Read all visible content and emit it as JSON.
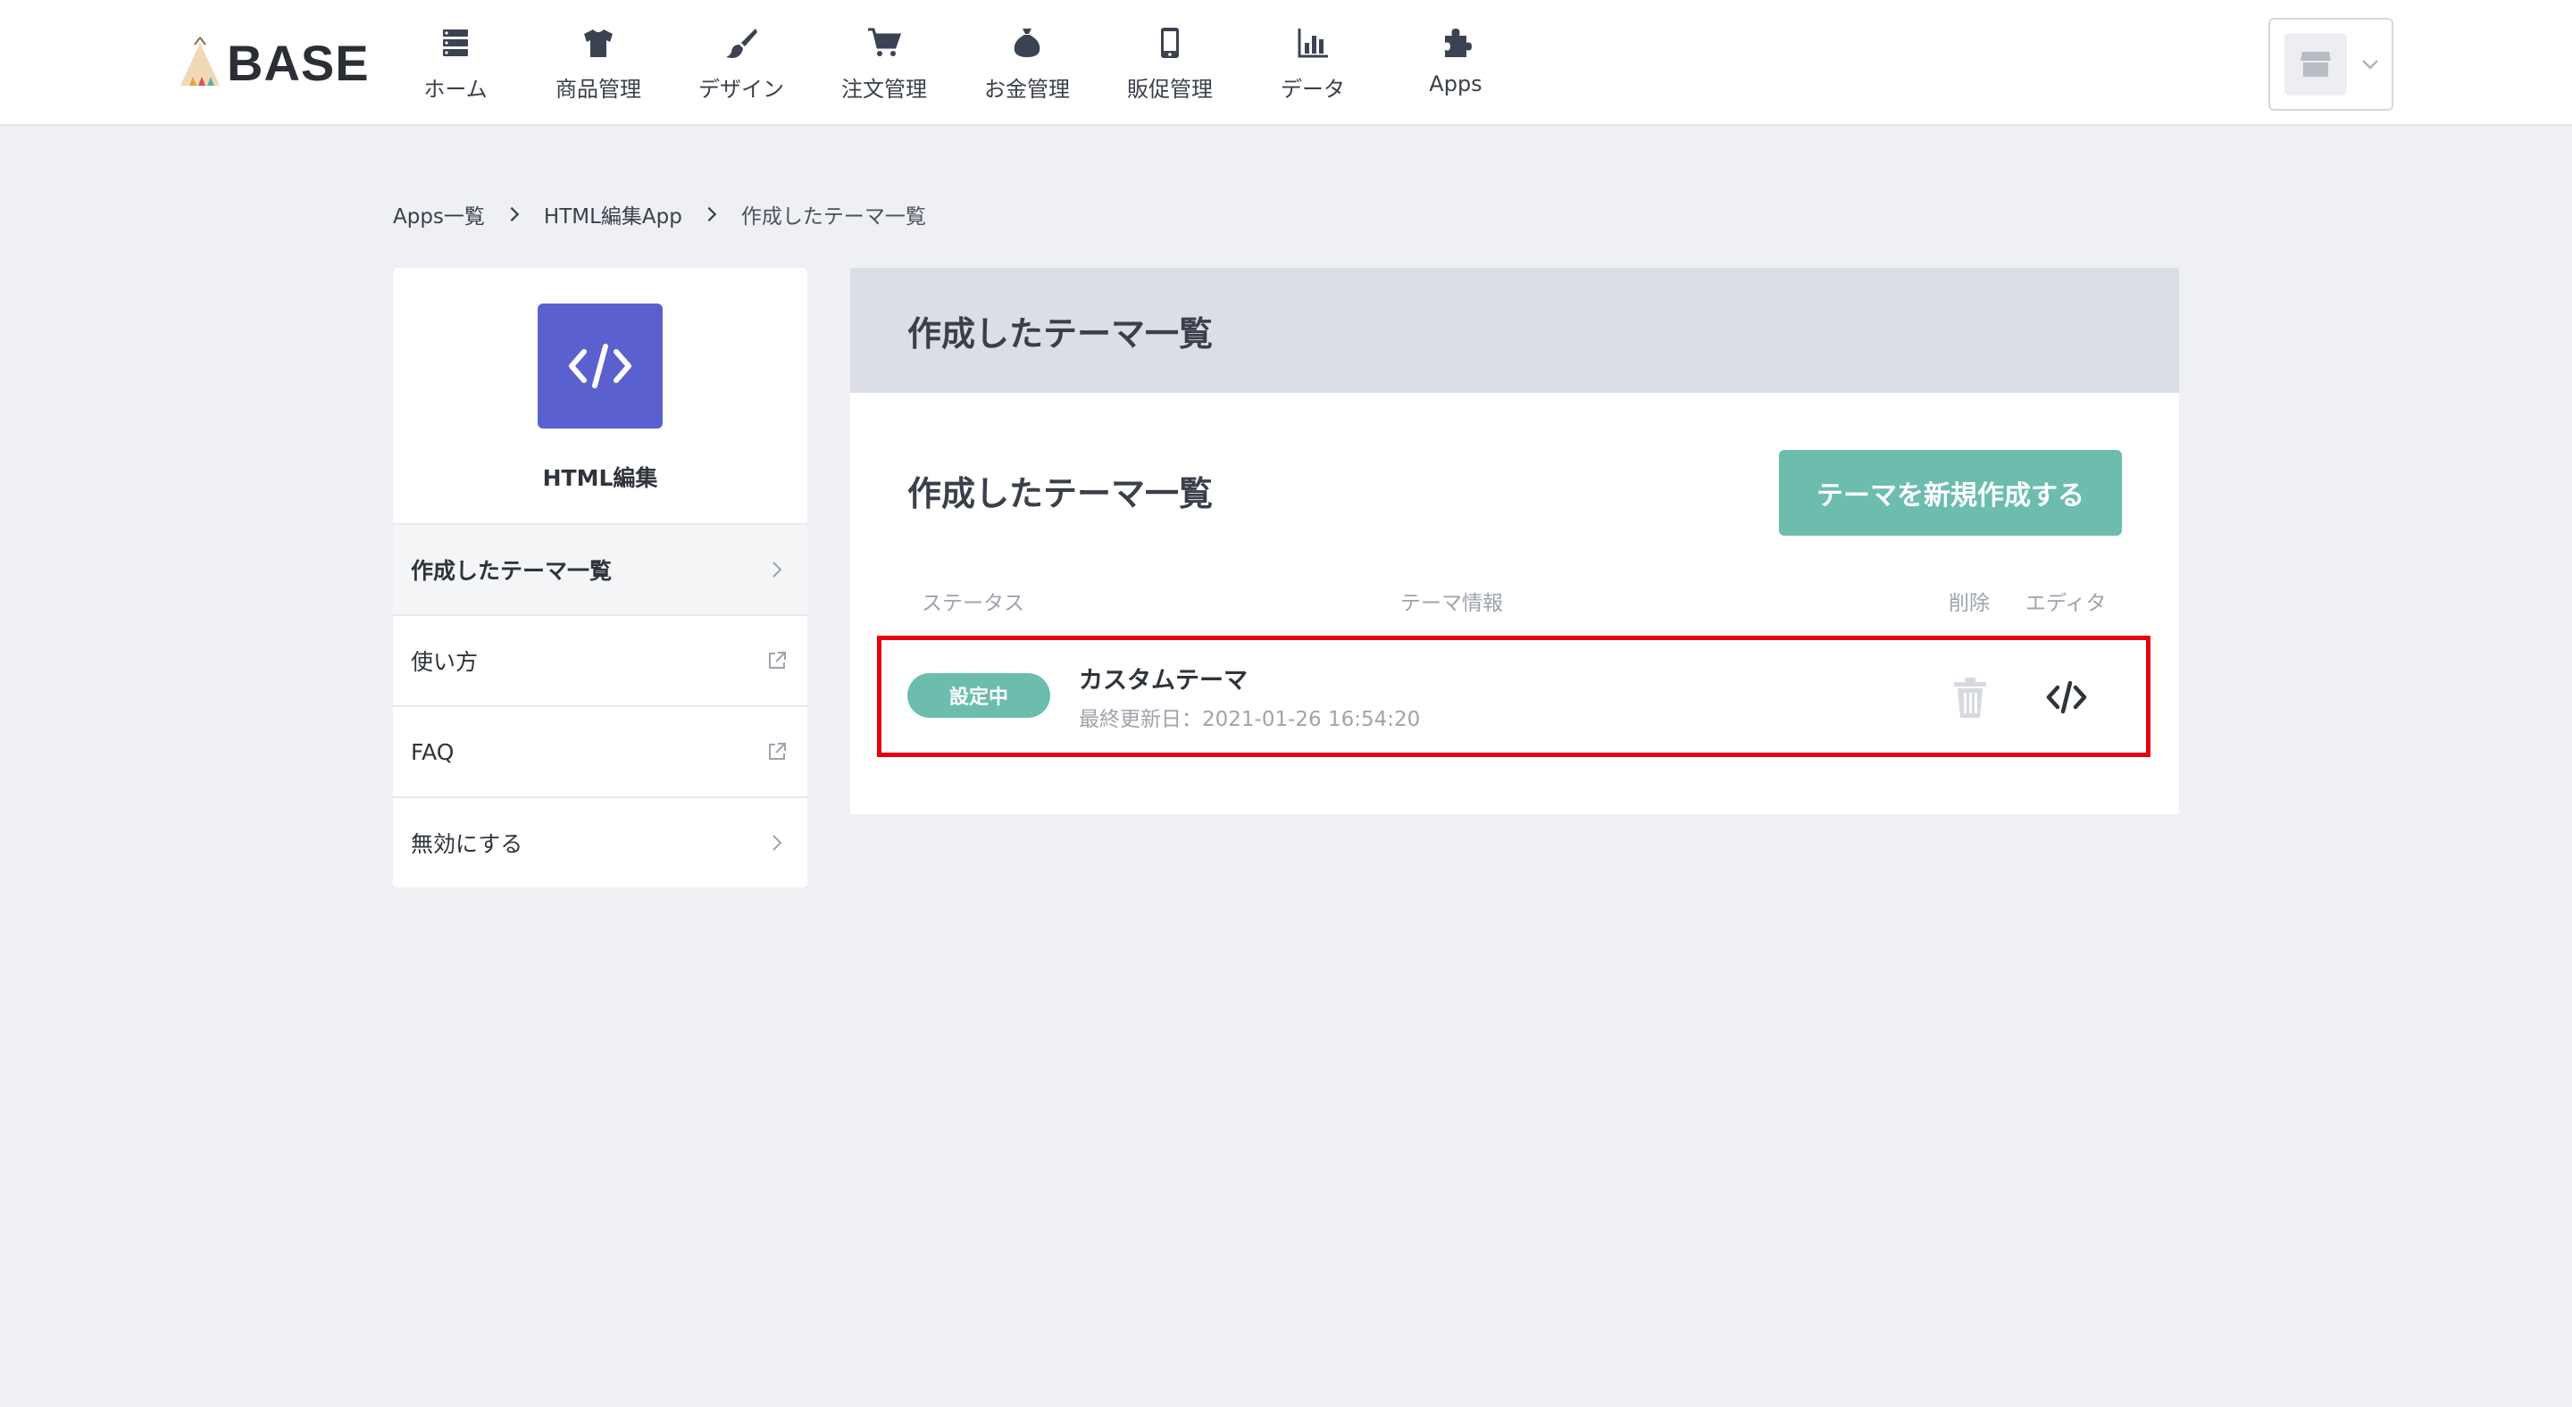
{
  "header": {
    "logo_text": "BASE",
    "nav": [
      {
        "label": "ホーム",
        "icon": "server-icon"
      },
      {
        "label": "商品管理",
        "icon": "tshirt-icon"
      },
      {
        "label": "デザイン",
        "icon": "paintbrush-icon"
      },
      {
        "label": "注文管理",
        "icon": "cart-icon"
      },
      {
        "label": "お金管理",
        "icon": "money-bag-icon"
      },
      {
        "label": "販促管理",
        "icon": "smartphone-icon"
      },
      {
        "label": "データ",
        "icon": "bar-chart-icon"
      },
      {
        "label": "Apps",
        "icon": "puzzle-icon"
      }
    ],
    "shop_icon": "storefront-icon"
  },
  "breadcrumb": [
    {
      "label": "Apps一覧"
    },
    {
      "label": "HTML編集App"
    },
    {
      "label": "作成したテーマ一覧"
    }
  ],
  "sidebar": {
    "app_icon": "code-icon",
    "app_name": "HTML編集",
    "items": [
      {
        "label": "作成したテーマ一覧",
        "icon": "chevron-right-icon",
        "active": true
      },
      {
        "label": "使い方",
        "icon": "external-link-icon"
      },
      {
        "label": "FAQ",
        "icon": "external-link-icon"
      },
      {
        "label": "無効にする",
        "icon": "chevron-right-icon"
      }
    ]
  },
  "main": {
    "header_title": "作成したテーマ一覧",
    "section_title": "作成したテーマ一覧",
    "new_button_label": "テーマを新規作成する",
    "columns": {
      "status": "ステータス",
      "info": "テーマ情報",
      "delete": "削除",
      "editor": "エディタ"
    },
    "themes": [
      {
        "status": "設定中",
        "name": "カスタムテーマ",
        "updated": "最終更新日：2021-01-26 16:54:20"
      }
    ]
  },
  "colors": {
    "accent": "#6cbdad",
    "app_icon_bg": "#5b60cf",
    "highlight_border": "#e60012",
    "background": "#eff0f4"
  }
}
